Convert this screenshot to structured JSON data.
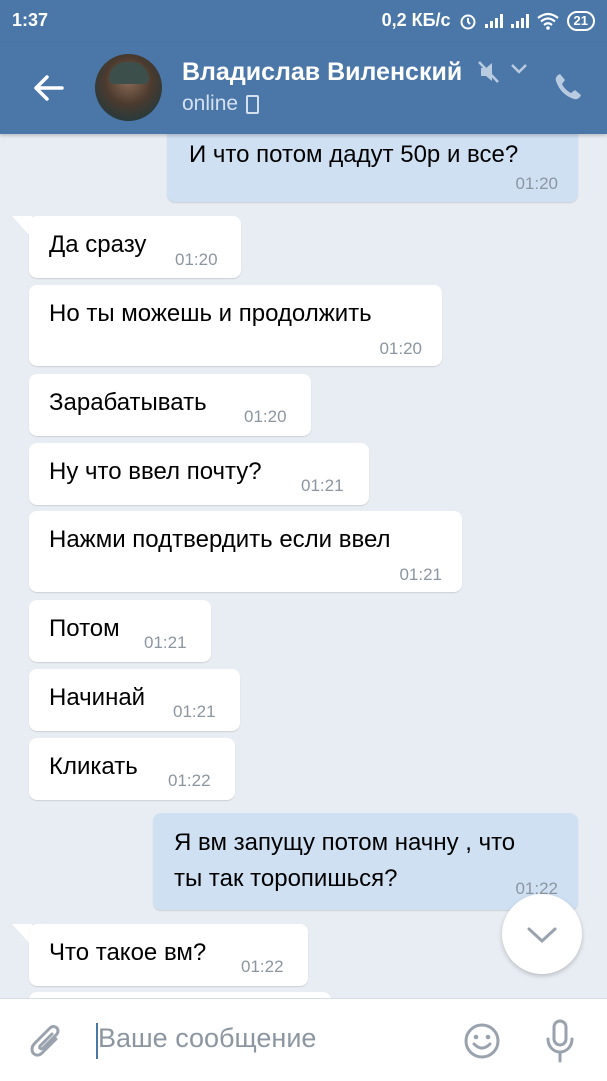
{
  "statusbar": {
    "time": "1:37",
    "speed": "0,2 КБ/с",
    "battery": "21"
  },
  "header": {
    "name": "Владислав Виленский",
    "status": "online"
  },
  "messages": [
    {
      "dir": "out",
      "text": "И что потом дадут 50р и все?",
      "time": "01:20"
    },
    {
      "dir": "in",
      "text": "Да сразу",
      "time": "01:20"
    },
    {
      "dir": "in",
      "text": "Но ты можешь и продолжить",
      "time": "01:20"
    },
    {
      "dir": "in",
      "text": "Зарабатывать",
      "time": "01:20"
    },
    {
      "dir": "in",
      "text": "Ну что ввел почту?",
      "time": "01:21"
    },
    {
      "dir": "in",
      "text": "Нажми подтвердить если ввел",
      "time": "01:21"
    },
    {
      "dir": "in",
      "text": "Потом",
      "time": "01:21"
    },
    {
      "dir": "in",
      "text": "Начинай",
      "time": "01:21"
    },
    {
      "dir": "in",
      "text": "Кликать",
      "time": "01:22"
    },
    {
      "dir": "out",
      "text_line1": "Я вм запущу потом начну , что",
      "text_line2": "ты так торопишься?",
      "time": "01:22"
    },
    {
      "dir": "in",
      "text": "Что такое вм?",
      "time": "01:22"
    }
  ],
  "input": {
    "placeholder": "Ваше сообщение"
  },
  "icons": {
    "back": "arrow-left-icon",
    "mute": "mute-icon",
    "dropdown": "chevron-down-icon",
    "call": "phone-icon",
    "attach": "paperclip-icon",
    "emoji": "smile-icon",
    "mic": "microphone-icon",
    "scroll": "chevron-down-icon"
  },
  "colors": {
    "accent": "#4a76a8",
    "outgoing_bubble": "#cfe0f3",
    "incoming_bubble": "#ffffff",
    "background": "#e8edf3"
  }
}
